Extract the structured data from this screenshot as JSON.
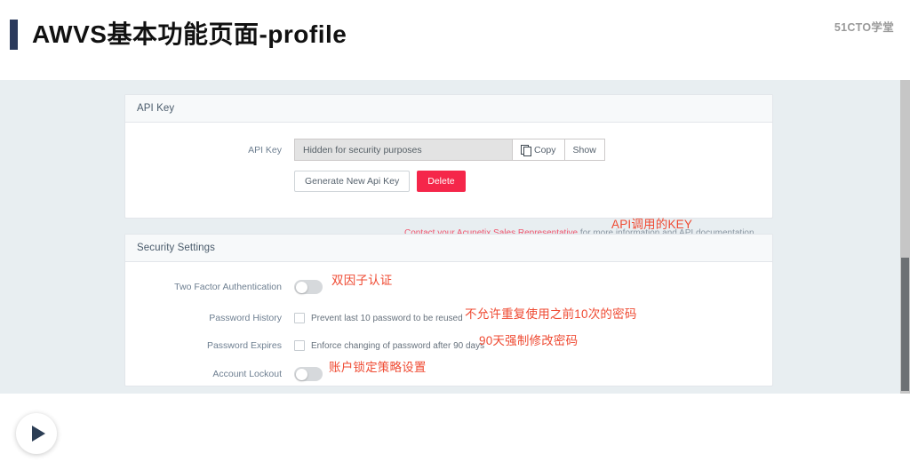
{
  "slide": {
    "title": "AWVS基本功能页面-profile",
    "brand": "51CTO学堂"
  },
  "api_panel": {
    "header": "API Key",
    "api_key_label": "API Key",
    "api_key_value": "Hidden for security purposes",
    "copy_button": "Copy",
    "show_button": "Show",
    "generate_button": "Generate New Api Key",
    "delete_button": "Delete",
    "contact_link": "Contact your Acunetix Sales Representative",
    "contact_rest": " for more information and API documentation",
    "annotation": "API调用的KEY"
  },
  "security_panel": {
    "header": "Security Settings",
    "rows": [
      {
        "label": "Two Factor Authentication",
        "control": "toggle",
        "state": "off",
        "text": "",
        "annotation": "双因子认证"
      },
      {
        "label": "Password History",
        "control": "checkbox",
        "state": "unchecked",
        "text": "Prevent last 10 password to be reused",
        "annotation": "不允许重复使用之前10次的密码"
      },
      {
        "label": "Password Expires",
        "control": "checkbox",
        "state": "unchecked",
        "text": "Enforce changing of password after 90 days",
        "annotation": "90天强制修改密码"
      },
      {
        "label": "Account Lockout",
        "control": "toggle",
        "state": "off",
        "text": "",
        "annotation": "账户锁定策略设置"
      }
    ]
  },
  "colors": {
    "accent_bar": "#2b3a5c",
    "danger": "#f5264a",
    "link": "#f0576f",
    "annotation": "#ef4a32",
    "page_bg": "#e8eef1"
  }
}
